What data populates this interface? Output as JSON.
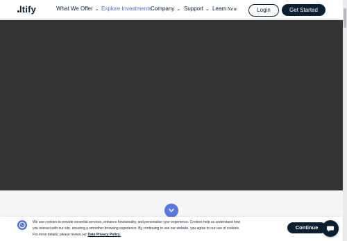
{
  "logo": {
    "text": "ltify"
  },
  "nav": {
    "items": [
      {
        "label": "What We Offer",
        "chevron": "chevron-down-icon"
      },
      {
        "label": "Explore Investments"
      },
      {
        "label": "Company",
        "chevron": "chevron-down-icon"
      },
      {
        "label": "Support",
        "chevron": "chevron-down-icon"
      },
      {
        "label": "Learn",
        "badge": "New"
      }
    ],
    "login_label": "Login",
    "get_started_label": "Get Started"
  },
  "cookie": {
    "line1": "We use cookies to provide essential services, enhance functionality, and personalise your experience. Cookies help us understand how",
    "line2": "you interact with our site, ensuring a smoother browsing experience. By continuing to use our website, you agree to our use of cookies.",
    "line3_prefix": "For more details, please review our ",
    "policy_link": "Data Privacy Policy.",
    "continue_label": "Continue"
  },
  "colors": {
    "brand_dark": "#0b1f33",
    "accent": "#4f6ed9",
    "hero_bg": "#333333"
  }
}
